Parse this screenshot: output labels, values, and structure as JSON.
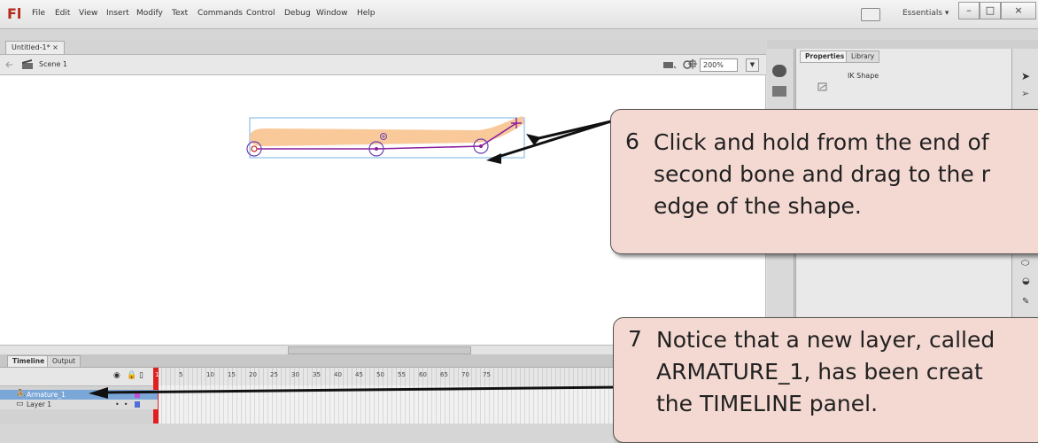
{
  "app": {
    "logo": "Fl"
  },
  "menu": [
    "File",
    "Edit",
    "View",
    "Insert",
    "Modify",
    "Text",
    "Commands",
    "Control",
    "Debug",
    "Window",
    "Help"
  ],
  "workspace": {
    "label": "Essentials ▾"
  },
  "window_buttons": {
    "minimize": "–",
    "maximize": "□",
    "close": "×"
  },
  "document": {
    "tab": "Untitled-1*  ×",
    "scene": "Scene 1",
    "zoom": "200%"
  },
  "properties": {
    "tabs": [
      "Properties",
      "Library"
    ],
    "selection": "IK Shape"
  },
  "timeline": {
    "tabs": [
      "Timeline",
      "Output"
    ],
    "frame_numbers": [
      "1",
      "5",
      "10",
      "15",
      "20",
      "25",
      "30",
      "35",
      "40",
      "45",
      "50",
      "55",
      "60",
      "65",
      "70",
      "75"
    ],
    "layers": [
      {
        "name": "Armature_1"
      },
      {
        "name": "Layer 1"
      }
    ]
  },
  "callouts": [
    {
      "number": "6",
      "lines": [
        "Click and hold from the end of",
        "second bone and drag to the r",
        "edge of the shape."
      ]
    },
    {
      "number": "7",
      "lines": [
        "Notice that a new layer, called",
        "ARMATURE_1, has been creat",
        "the TIMELINE panel."
      ]
    }
  ],
  "colors": {
    "shape_fill": "#f9c99a",
    "bone": "#8a1d9c",
    "selection": "#76b3e6",
    "callout_bg": "#f4d9d2",
    "frame_marker": "#e02020"
  }
}
